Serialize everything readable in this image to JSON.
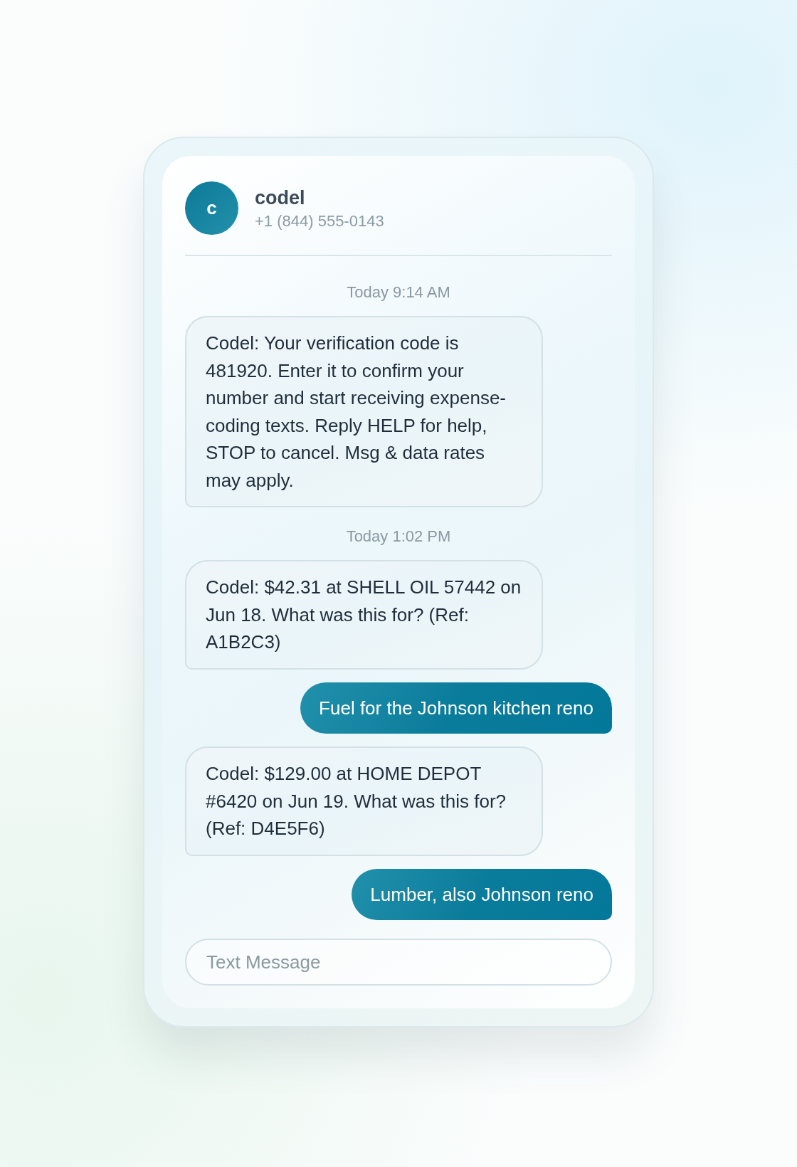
{
  "contact": {
    "initial": "c",
    "name": "codel",
    "phone": "+1 (844) 555-0143"
  },
  "messages": [
    {
      "kind": "timestamp",
      "text": "Today 9:14 AM"
    },
    {
      "kind": "incoming",
      "text": "Codel: Your verification code is 481920. Enter it to confirm your number and start receiving expense-coding texts. Reply HELP for help, STOP to cancel. Msg & data rates may apply."
    },
    {
      "kind": "timestamp",
      "text": "Today 1:02 PM"
    },
    {
      "kind": "incoming",
      "text": "Codel: $42.31 at SHELL OIL 57442 on Jun 18. What was this for? (Ref: A1B2C3)"
    },
    {
      "kind": "outgoing",
      "text": "Fuel for the Johnson kitchen reno"
    },
    {
      "kind": "incoming",
      "text": "Codel: $129.00 at HOME DEPOT #6420 on Jun 19. What was this for? (Ref: D4E5F6)"
    },
    {
      "kind": "outgoing",
      "text": "Lumber, also Johnson reno"
    }
  ],
  "composer": {
    "placeholder": "Text Message"
  }
}
